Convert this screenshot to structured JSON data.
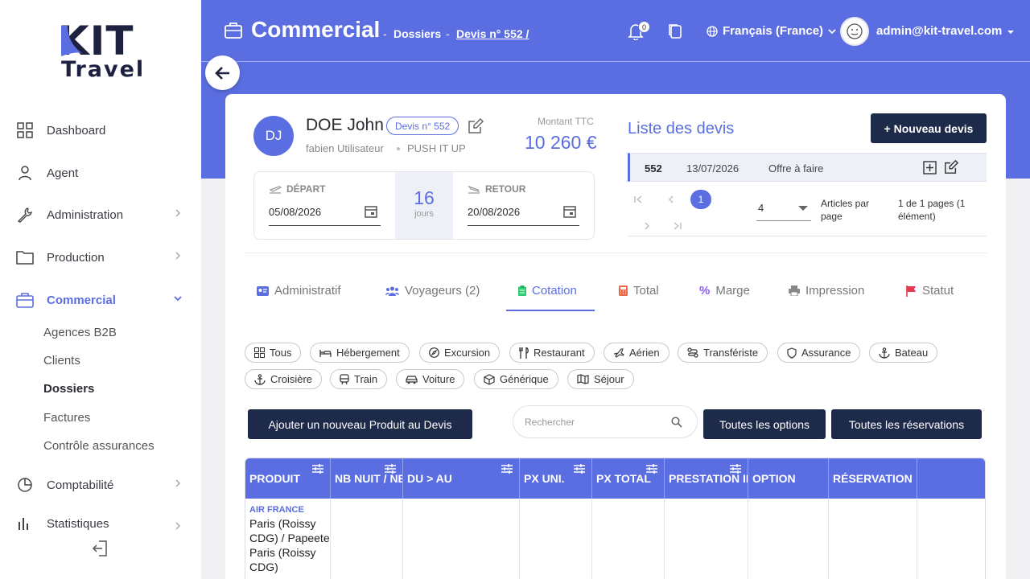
{
  "logo": {
    "line1": "KIT",
    "line2": "Travel"
  },
  "sidebar": {
    "items": [
      {
        "label": "Dashboard"
      },
      {
        "label": "Agent"
      },
      {
        "label": "Administration"
      },
      {
        "label": "Production"
      },
      {
        "label": "Commercial"
      },
      {
        "label": "Comptabilité"
      },
      {
        "label": "Statistiques"
      }
    ],
    "sub_items": [
      "Agences B2B",
      "Clients",
      "Dossiers",
      "Factures",
      "Contrôle assurances"
    ]
  },
  "header": {
    "title": "Commercial",
    "sep": "-",
    "crumb1": "Dossiers",
    "crumb2": "Devis n° 552 /",
    "notif_count": "0",
    "language": "Français (France)",
    "user_email": "admin@kit-travel.com"
  },
  "client": {
    "initials": "DJ",
    "name": "DOE John",
    "devis_badge": "Devis n° 552",
    "user": "fabien Utilisateur",
    "source": "PUSH IT UP",
    "amount_label": "Montant TTC",
    "amount": "10 260 €"
  },
  "dates": {
    "depart_label": "DÉPART",
    "depart_value": "05/08/2026",
    "nights": "16",
    "nights_label": "jours",
    "retour_label": "RETOUR",
    "retour_value": "20/08/2026"
  },
  "devis_list": {
    "title": "Liste des devis",
    "new_button": "+ Nouveau devis",
    "rows": [
      {
        "num": "552",
        "date": "13/07/2026",
        "status": "Offre à faire"
      }
    ],
    "current_page": "1",
    "per_page": "4",
    "per_page_label": "Articles par page",
    "page_info": "1 de 1 pages (1 élément)"
  },
  "tabs": [
    {
      "label": "Administratif"
    },
    {
      "label": "Voyageurs (2)"
    },
    {
      "label": "Cotation"
    },
    {
      "label": "Total"
    },
    {
      "label": "Marge"
    },
    {
      "label": "Impression"
    },
    {
      "label": "Statut"
    }
  ],
  "filters": [
    "Tous",
    "Hébergement",
    "Excursion",
    "Restaurant",
    "Aérien",
    "Transfériste",
    "Assurance",
    "Bateau",
    "Croisière",
    "Train",
    "Voiture",
    "Générique",
    "Séjour"
  ],
  "actions": {
    "add_product": "Ajouter un nouveau Produit au Devis",
    "search_placeholder": "Rechercher",
    "all_options": "Toutes les options",
    "all_reservations": "Toutes les réservations"
  },
  "table": {
    "columns": [
      "PRODUIT",
      "NB NUIT / NB",
      "DU > AU",
      "PX UNI.",
      "PX TOTAL",
      "PRESTATION INCLUSE",
      "OPTION",
      "RÉSERVATION"
    ],
    "rows": [
      {
        "airline": "AIR FRANCE",
        "route": "Paris (Roissy CDG) / Papeete Paris (Roissy CDG)"
      }
    ]
  },
  "colors": {
    "accent": "#5b6ee1",
    "dark_button": "#1e2a4a",
    "flag": "#e53950",
    "calc": "#f06a4a",
    "clipboard": "#2ecc71"
  }
}
